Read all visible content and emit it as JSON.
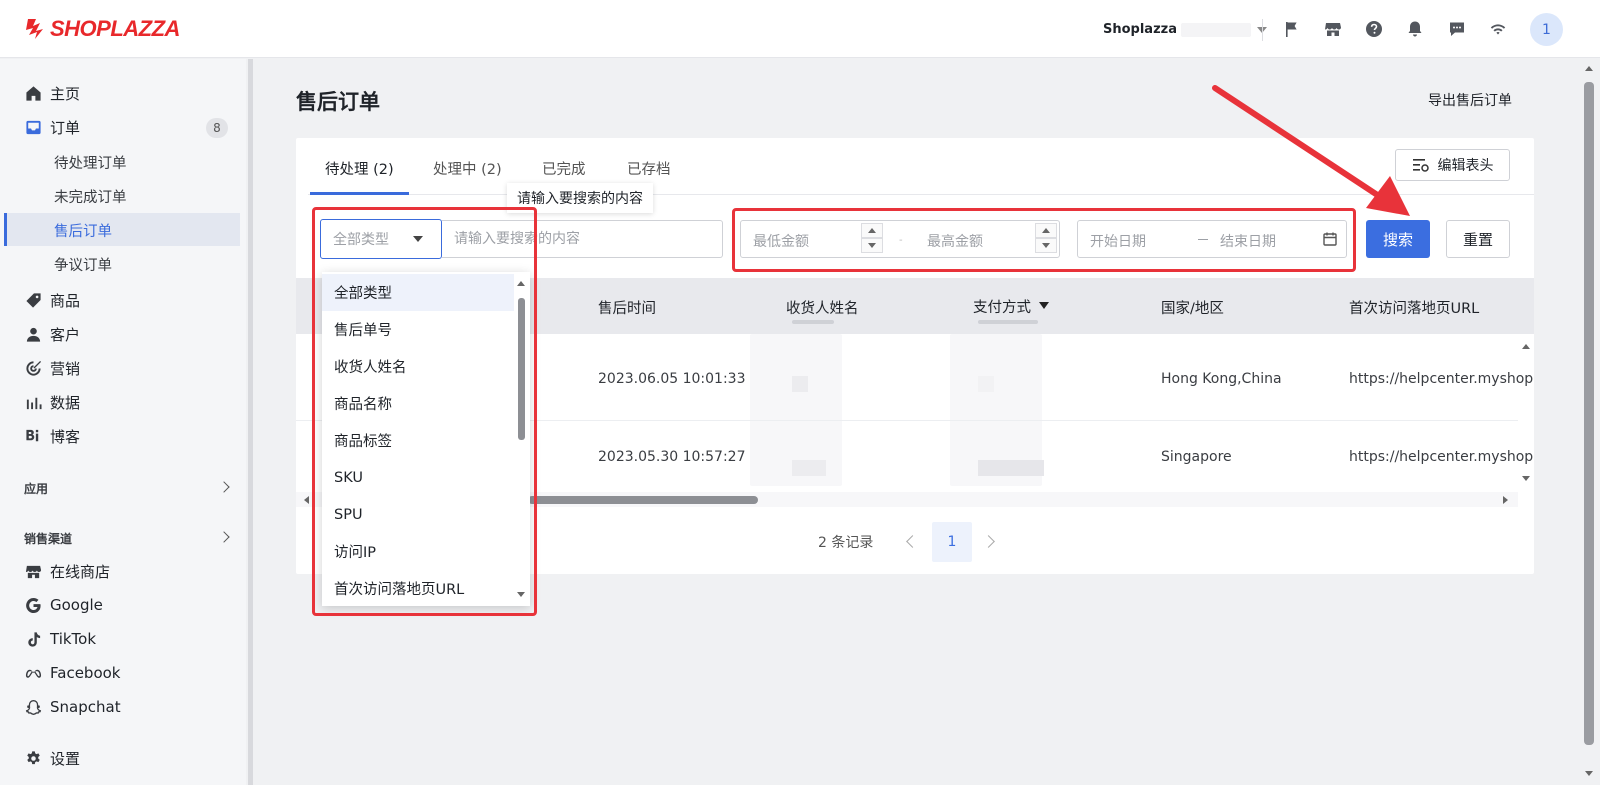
{
  "topbar": {
    "logo_text": "SHOPLAZZA",
    "store_name": "Shoplazza",
    "avatar_initial": "1",
    "icons": [
      "flag-icon",
      "store-icon",
      "help-icon",
      "bell-icon",
      "message-icon",
      "wifi-icon"
    ]
  },
  "sidebar": {
    "home": "主页",
    "orders": "订单",
    "orders_badge": "8",
    "orders_sub": [
      "待处理订单",
      "未完成订单",
      "售后订单",
      "争议订单"
    ],
    "products": "商品",
    "customers": "客户",
    "marketing": "营销",
    "analytics": "数据",
    "blog": "博客",
    "apps_title": "应用",
    "channels_title": "销售渠道",
    "online_store": "在线商店",
    "google": "Google",
    "tiktok": "TikTok",
    "facebook": "Facebook",
    "snapchat": "Snapchat",
    "settings": "设置"
  },
  "main": {
    "title": "售后订单",
    "export_link": "导出售后订单",
    "tabs": [
      {
        "label": "待处理 (2)",
        "active": true
      },
      {
        "label": "处理中 (2)",
        "active": false
      },
      {
        "label": "已完成",
        "active": false
      },
      {
        "label": "已存档",
        "active": false
      }
    ],
    "edit_columns": "编辑表头",
    "tooltip": "请输入要搜索的内容",
    "filters": {
      "type_select": "全部类型",
      "search_placeholder": "请输入要搜索的内容",
      "min_amount": "最低金额",
      "max_amount": "最高金额",
      "amount_separator": "-",
      "start_date": "开始日期",
      "end_date": "结束日期",
      "search_button": "搜索",
      "reset_button": "重置"
    },
    "table": {
      "headers": [
        "售后时间",
        "收货人姓名",
        "支付方式",
        "国家/地区",
        "首次访问落地页URL"
      ],
      "rows": [
        {
          "time": "2023.06.05 10:01:33",
          "country": "Hong Kong,China",
          "url": "https://helpcenter.myshop"
        },
        {
          "time": "2023.05.30 10:57:27",
          "country": "Singapore",
          "url": "https://helpcenter.myshop"
        }
      ]
    },
    "pagination": {
      "total": "2 条记录",
      "current_page": "1"
    },
    "type_dropdown": [
      "全部类型",
      "售后单号",
      "收货人姓名",
      "商品名称",
      "商品标签",
      "SKU",
      "SPU",
      "访问IP",
      "首次访问落地页URL"
    ]
  },
  "colors": {
    "accent": "#3b6ee0",
    "annotation": "#e8333a",
    "brand": "#e8282b"
  }
}
